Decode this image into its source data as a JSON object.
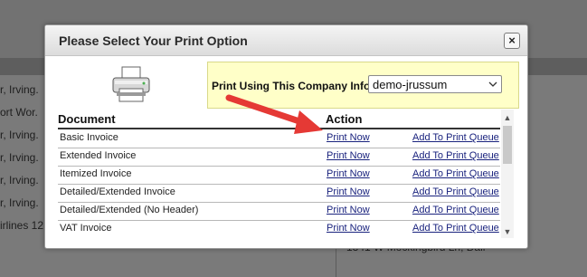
{
  "background": {
    "rows": [
      "r, Irving.",
      "ort Wor.",
      "r, Irving.",
      "r, Irving.",
      "r, Irving.",
      "r, Irving.",
      "irlines 12..."
    ],
    "right_text": "1341 W Mockingbird Ln, Dall"
  },
  "modal": {
    "title": "Please Select Your Print Option",
    "close_label": "×",
    "company": {
      "label": "Print Using This Company Info:",
      "selected": "demo-jrussum"
    },
    "table": {
      "headers": {
        "document": "Document",
        "action": "Action"
      },
      "rows": [
        {
          "document": "Basic Invoice",
          "print": "Print Now",
          "queue": "Add To Print Queue"
        },
        {
          "document": "Extended Invoice",
          "print": "Print Now",
          "queue": "Add To Print Queue"
        },
        {
          "document": "Itemized Invoice",
          "print": "Print Now",
          "queue": "Add To Print Queue"
        },
        {
          "document": "Detailed/Extended Invoice",
          "print": "Print Now",
          "queue": "Add To Print Queue"
        },
        {
          "document": "Detailed/Extended (No Header)",
          "print": "Print Now",
          "queue": "Add To Print Queue"
        },
        {
          "document": "VAT Invoice",
          "print": "Print Now",
          "queue": "Add To Print Queue"
        }
      ]
    }
  },
  "colors": {
    "overlay": "#7f7f7f",
    "highlight_box": "#ffffc8",
    "link": "#1a237e",
    "annotation_arrow": "#e53935"
  },
  "icons": [
    "printer-icon",
    "close-icon",
    "chevron-down-icon",
    "scroll-up-icon",
    "scroll-down-icon",
    "annotation-arrow"
  ]
}
